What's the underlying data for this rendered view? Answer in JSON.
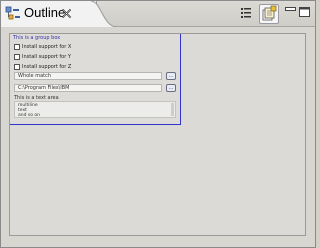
{
  "view": {
    "title": "Outline",
    "toolbar": {
      "tool1": "list-tree-icon",
      "tool2": "sync-outline-icon",
      "minimize": "minimize-icon",
      "maximize": "maximize-icon"
    }
  },
  "form": {
    "group_label": "This is a group box",
    "checkboxes": [
      {
        "label": "Install support for X"
      },
      {
        "label": "Install support for Y"
      },
      {
        "label": "Install support for Z"
      }
    ],
    "field1": {
      "value": "Whole match",
      "button": "..."
    },
    "field2": {
      "value": "C:\\Program Files\\IBM",
      "button": "..."
    },
    "text_area": {
      "label": "This is a text area",
      "lines": [
        "multiline",
        "text",
        "and so on"
      ]
    }
  }
}
